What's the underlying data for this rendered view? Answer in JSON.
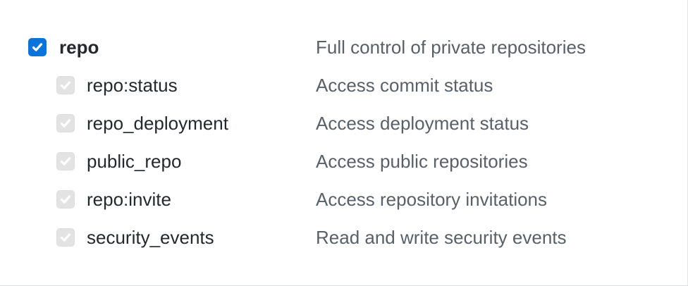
{
  "scopes": {
    "parent": {
      "name": "repo",
      "description": "Full control of private repositories",
      "checked": true
    },
    "children": [
      {
        "name": "repo:status",
        "description": "Access commit status",
        "checked": true,
        "disabled": true
      },
      {
        "name": "repo_deployment",
        "description": "Access deployment status",
        "checked": true,
        "disabled": true
      },
      {
        "name": "public_repo",
        "description": "Access public repositories",
        "checked": true,
        "disabled": true
      },
      {
        "name": "repo:invite",
        "description": "Access repository invitations",
        "checked": true,
        "disabled": true
      },
      {
        "name": "security_events",
        "description": "Read and write security events",
        "checked": true,
        "disabled": true
      }
    ]
  },
  "colors": {
    "accent": "#0a74da",
    "text": "#24292e",
    "muted_text": "#586069",
    "disabled_checkbox": "#e3e3e3"
  },
  "icons": {
    "checked": "check-icon"
  }
}
